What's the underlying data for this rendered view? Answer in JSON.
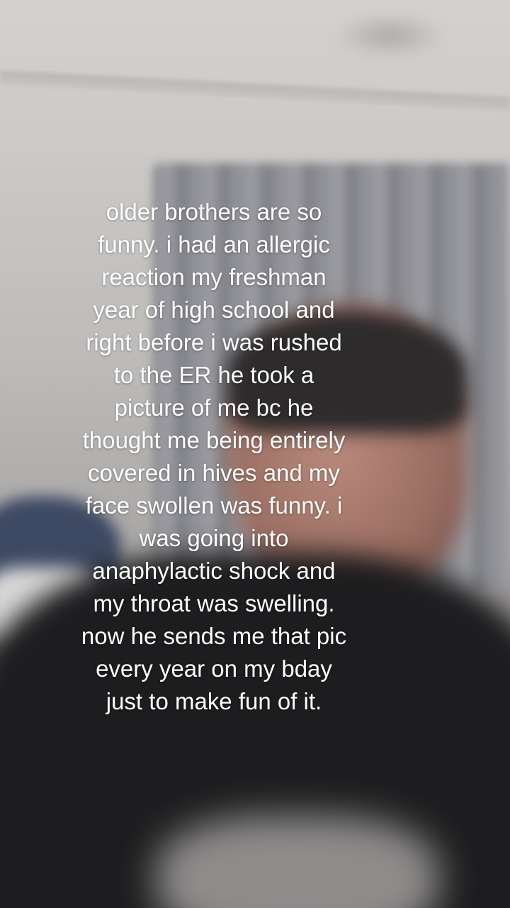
{
  "caption": {
    "lines": [
      "older brothers are so",
      "funny. i had an allergic",
      "reaction my freshman",
      "year of high school and",
      "right before i was rushed",
      "to the ER he took a",
      "picture of me bc he",
      "thought me being entirely",
      "covered in hives and my",
      "face swollen was funny. i",
      "was going into",
      "anaphylactic shock and",
      "my throat was swelling.",
      "now he sends me that pic",
      "every year on my bday",
      "just to make fun of it."
    ]
  }
}
